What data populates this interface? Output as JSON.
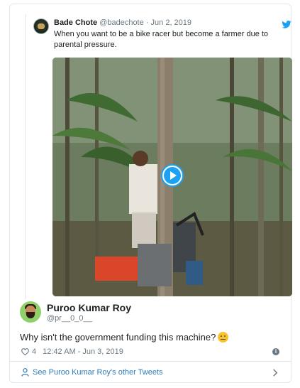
{
  "quoted_tweet": {
    "author_name": "Bade Chote",
    "author_handle": "@badechote",
    "separator": "·",
    "date": "Jun 2, 2019",
    "text": "When you want to be a bike racer but become a farmer due to parental pressure.",
    "media": {
      "type": "video",
      "play_icon": "play-icon"
    }
  },
  "tweet": {
    "author_name": "Puroo Kumar Roy",
    "author_handle": "@pr__0_0__",
    "text": "Why isn't the government funding this machine?",
    "emoji": "neutral-face-emoji",
    "like_count": "4",
    "timestamp": "12:42 AM - Jun 3, 2019"
  },
  "footer": {
    "link_text": "See Puroo Kumar Roy's other Tweets"
  },
  "colors": {
    "accent": "#1da1f2",
    "link": "#2b7bb9",
    "muted": "#697882",
    "text": "#1c2022",
    "border": "#e1e8ed",
    "avatar_bg": "#8ed16a"
  },
  "icons": [
    "twitter-bird-icon",
    "play-icon",
    "heart-icon",
    "info-icon",
    "person-icon",
    "chevron-right-icon"
  ]
}
